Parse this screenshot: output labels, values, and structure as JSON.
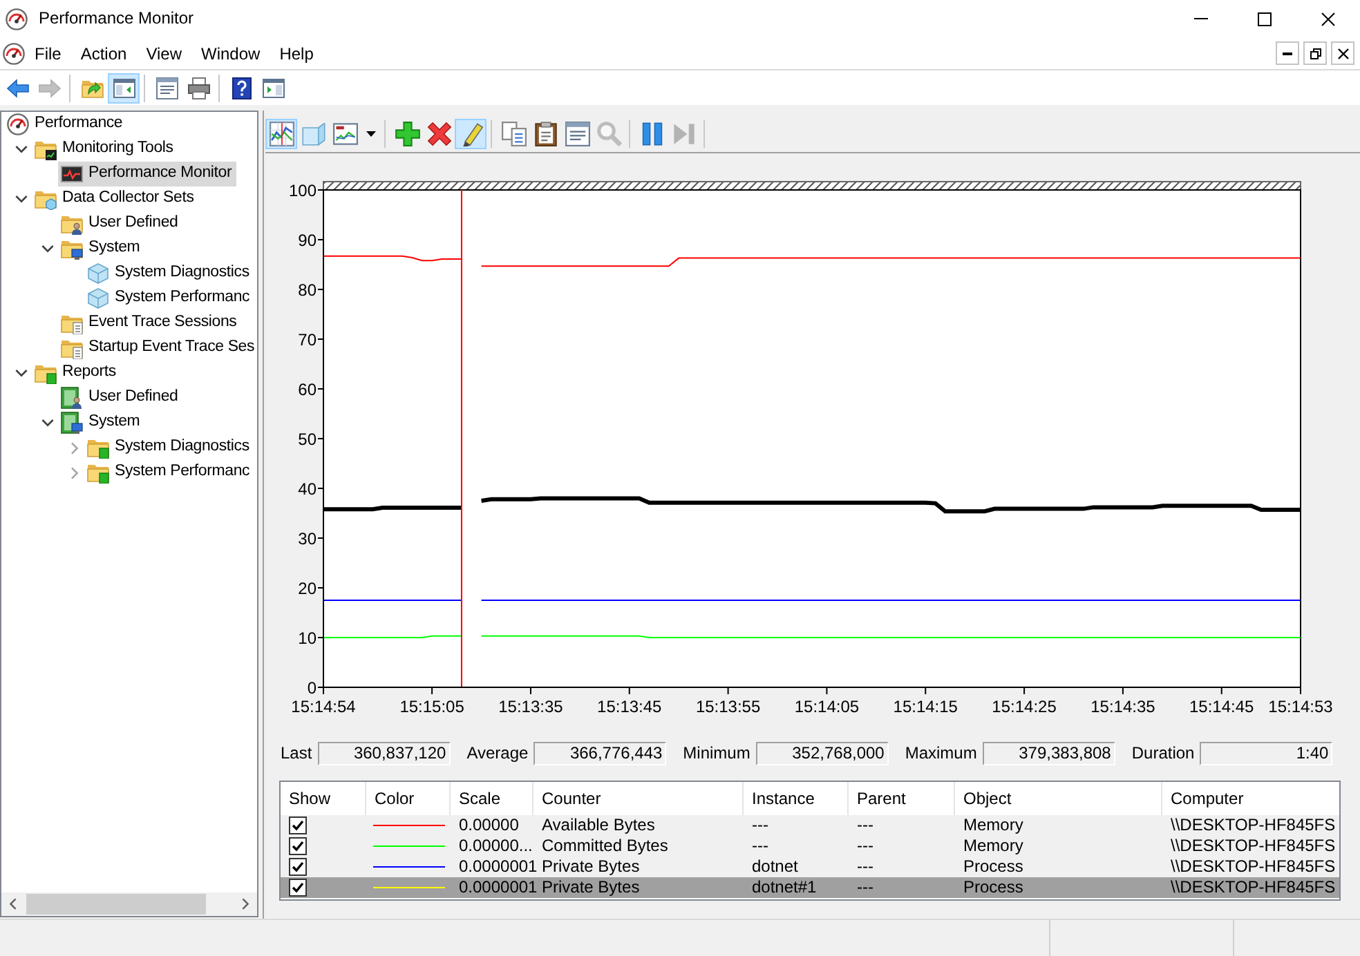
{
  "window": {
    "title": "Performance Monitor"
  },
  "menu": [
    "File",
    "Action",
    "View",
    "Window",
    "Help"
  ],
  "toolbar": [
    {
      "kind": "back",
      "pressed": false,
      "disabled": false
    },
    {
      "kind": "forward",
      "pressed": false,
      "disabled": true
    },
    {
      "kind": "separator"
    },
    {
      "kind": "up",
      "pressed": false,
      "disabled": false
    },
    {
      "kind": "consoletree",
      "pressed": true,
      "disabled": false
    },
    {
      "kind": "separator"
    },
    {
      "kind": "properties",
      "pressed": false,
      "disabled": false
    },
    {
      "kind": "print",
      "pressed": false,
      "disabled": false
    },
    {
      "kind": "separator"
    },
    {
      "kind": "help",
      "pressed": false,
      "disabled": false
    },
    {
      "kind": "actionpane",
      "pressed": false,
      "disabled": false
    }
  ],
  "tree": [
    {
      "label": "Performance",
      "kind": "root",
      "selected": false,
      "children": [
        {
          "label": "Monitoring Tools",
          "kind": "tools",
          "expanded": true,
          "selected": false,
          "children": [
            {
              "label": "Performance Monitor",
              "kind": "monitor",
              "selected": true
            }
          ]
        },
        {
          "label": "Data Collector Sets",
          "kind": "collector",
          "expanded": true,
          "selected": false,
          "children": [
            {
              "label": "User Defined",
              "kind": "userset",
              "selected": false
            },
            {
              "label": "System",
              "kind": "systemset",
              "expanded": true,
              "selected": false,
              "children": [
                {
                  "label": "System Diagnostics",
                  "kind": "dataset",
                  "selected": false
                },
                {
                  "label": "System Performanc",
                  "kind": "dataset",
                  "selected": false
                }
              ]
            },
            {
              "label": "Event Trace Sessions",
              "kind": "trace",
              "selected": false
            },
            {
              "label": "Startup Event Trace Ses",
              "kind": "trace",
              "selected": false
            }
          ]
        },
        {
          "label": "Reports",
          "kind": "reports",
          "expanded": true,
          "selected": false,
          "children": [
            {
              "label": "User Defined",
              "kind": "userreport",
              "selected": false
            },
            {
              "label": "System",
              "kind": "systemreport",
              "expanded": true,
              "selected": false,
              "children": [
                {
                  "label": "System Diagnostics",
                  "kind": "reportfolder",
                  "expanded": false,
                  "selected": false
                },
                {
                  "label": "System Performanc",
                  "kind": "reportfolder",
                  "expanded": false,
                  "selected": false
                }
              ]
            }
          ]
        }
      ]
    }
  ],
  "graph_toolbar": [
    {
      "kind": "graph",
      "pressed": true,
      "disabled": false
    },
    {
      "kind": "histogram",
      "pressed": false,
      "disabled": false
    },
    {
      "kind": "report",
      "pressed": false,
      "disabled": false
    },
    {
      "kind": "dropdown",
      "pressed": false,
      "disabled": false
    },
    {
      "kind": "separator"
    },
    {
      "kind": "add",
      "pressed": false,
      "disabled": false
    },
    {
      "kind": "delete",
      "pressed": false,
      "disabled": false
    },
    {
      "kind": "highlight",
      "pressed": true,
      "disabled": false
    },
    {
      "kind": "separator"
    },
    {
      "kind": "copy",
      "pressed": false,
      "disabled": false
    },
    {
      "kind": "paste",
      "pressed": false,
      "disabled": false
    },
    {
      "kind": "properties",
      "pressed": false,
      "disabled": false
    },
    {
      "kind": "zoom",
      "pressed": false,
      "disabled": true
    },
    {
      "kind": "separator"
    },
    {
      "kind": "freeze",
      "pressed": false,
      "disabled": false
    },
    {
      "kind": "update",
      "pressed": false,
      "disabled": true
    },
    {
      "kind": "separator"
    }
  ],
  "graph": {
    "chart_data": {
      "type": "line",
      "categories": [
        "15:14:54",
        null,
        null,
        null,
        null,
        null,
        null,
        null,
        null,
        null,
        null,
        "15:15:05",
        null,
        null,
        null,
        null,
        null,
        null,
        null,
        null,
        null,
        "15:13:35",
        null,
        null,
        null,
        null,
        null,
        null,
        null,
        null,
        null,
        "15:13:45",
        null,
        null,
        null,
        null,
        null,
        null,
        null,
        null,
        null,
        "15:13:55",
        null,
        null,
        null,
        null,
        null,
        null,
        null,
        null,
        null,
        "15:14:05",
        null,
        null,
        null,
        null,
        null,
        null,
        null,
        null,
        null,
        "15:14:15",
        null,
        null,
        null,
        null,
        null,
        null,
        null,
        null,
        null,
        "15:14:25",
        null,
        null,
        null,
        null,
        null,
        null,
        null,
        null,
        null,
        "15:14:35",
        null,
        null,
        null,
        null,
        null,
        null,
        null,
        null,
        null,
        "15:14:45",
        null,
        null,
        null,
        null,
        null,
        null,
        null,
        "15:14:53"
      ],
      "series": [
        {
          "color": "#ff0000",
          "values": [
            86.7,
            86.7,
            86.7,
            86.7,
            86.7,
            86.7,
            86.7,
            86.7,
            86.7,
            86.4,
            85.8,
            85.8,
            86.1,
            86.1,
            86.1,
            null,
            84.7,
            84.7,
            84.7,
            84.7,
            84.7,
            84.7,
            84.7,
            84.7,
            84.7,
            84.7,
            84.7,
            84.7,
            84.7,
            84.7,
            84.7,
            84.7,
            84.7,
            84.7,
            84.7,
            84.7,
            86.3,
            86.3,
            86.3,
            86.3,
            86.3,
            86.3,
            86.3,
            86.3,
            86.3,
            86.3,
            86.3,
            86.3,
            86.3,
            86.3,
            86.3,
            86.3,
            86.3,
            86.3,
            86.3,
            86.3,
            86.3,
            86.3,
            86.3,
            86.3,
            86.3,
            86.3,
            86.3,
            86.3,
            86.3,
            86.3,
            86.3,
            86.3,
            86.3,
            86.3,
            86.3,
            86.3,
            86.3,
            86.3,
            86.3,
            86.3,
            86.3,
            86.3,
            86.3,
            86.3,
            86.3,
            86.3,
            86.3,
            86.3,
            86.3,
            86.3,
            86.3,
            86.3,
            86.3,
            86.3,
            86.3,
            86.3,
            86.3,
            86.3,
            86.3,
            86.3,
            86.3,
            86.3,
            86.3,
            86.3
          ]
        },
        {
          "color": "#00ff00",
          "values": [
            10,
            10,
            10,
            10,
            10,
            10,
            10,
            10,
            10,
            10,
            10,
            10.3,
            10.3,
            10.3,
            10.3,
            null,
            10.3,
            10.3,
            10.3,
            10.3,
            10.3,
            10.3,
            10.3,
            10.3,
            10.3,
            10.3,
            10.3,
            10.3,
            10.3,
            10.3,
            10.3,
            10.3,
            10.3,
            10,
            10,
            10,
            10,
            10,
            10,
            10,
            10,
            10,
            10,
            10,
            10,
            10,
            10,
            10,
            10,
            10,
            10,
            10,
            10,
            10,
            10,
            10,
            10,
            10,
            10,
            10,
            10,
            10,
            10,
            10,
            10,
            10,
            10,
            10,
            10,
            10,
            10,
            10,
            10,
            10,
            10,
            10,
            10,
            10,
            10,
            10,
            10,
            10,
            10,
            10,
            10,
            10,
            10,
            10,
            10,
            10,
            10,
            10,
            10,
            10,
            10,
            10,
            10,
            10,
            10,
            10
          ]
        },
        {
          "color": "#0000ff",
          "values": [
            17.5,
            17.5,
            17.5,
            17.5,
            17.5,
            17.5,
            17.5,
            17.5,
            17.5,
            17.5,
            17.5,
            17.5,
            17.5,
            17.5,
            17.5,
            null,
            17.5,
            17.5,
            17.5,
            17.5,
            17.5,
            17.5,
            17.5,
            17.5,
            17.5,
            17.5,
            17.5,
            17.5,
            17.5,
            17.5,
            17.5,
            17.5,
            17.5,
            17.5,
            17.5,
            17.5,
            17.5,
            17.5,
            17.5,
            17.5,
            17.5,
            17.5,
            17.5,
            17.5,
            17.5,
            17.5,
            17.5,
            17.5,
            17.5,
            17.5,
            17.5,
            17.5,
            17.5,
            17.5,
            17.5,
            17.5,
            17.5,
            17.5,
            17.5,
            17.5,
            17.5,
            17.5,
            17.5,
            17.5,
            17.5,
            17.5,
            17.5,
            17.5,
            17.5,
            17.5,
            17.5,
            17.5,
            17.5,
            17.5,
            17.5,
            17.5,
            17.5,
            17.5,
            17.5,
            17.5,
            17.5,
            17.5,
            17.5,
            17.5,
            17.5,
            17.5,
            17.5,
            17.5,
            17.5,
            17.5,
            17.5,
            17.5,
            17.5,
            17.5,
            17.5,
            17.5,
            17.5,
            17.5,
            17.5,
            17.5
          ]
        },
        {
          "color": "#000000",
          "values": [
            35.8,
            35.8,
            35.8,
            35.8,
            35.8,
            35.8,
            36.1,
            36.1,
            36.1,
            36.1,
            36.1,
            36.1,
            36.1,
            36.1,
            36.1,
            null,
            37.5,
            37.8,
            37.8,
            37.8,
            37.8,
            37.8,
            38,
            38,
            38,
            38,
            38,
            38,
            38,
            38,
            38,
            38,
            38,
            37.1,
            37.1,
            37.1,
            37.1,
            37.1,
            37.1,
            37.1,
            37.1,
            37.1,
            37.1,
            37.1,
            37.1,
            37.1,
            37.1,
            37.1,
            37.1,
            37.1,
            37.1,
            37.1,
            37.1,
            37.1,
            37.1,
            37.1,
            37.1,
            37.1,
            37.1,
            37.1,
            37.1,
            37.1,
            37,
            35.4,
            35.4,
            35.4,
            35.4,
            35.4,
            35.9,
            35.9,
            35.9,
            35.9,
            35.9,
            35.9,
            35.9,
            35.9,
            35.9,
            35.9,
            36.2,
            36.2,
            36.2,
            36.2,
            36.2,
            36.2,
            36.2,
            36.5,
            36.5,
            36.5,
            36.5,
            36.5,
            36.5,
            36.5,
            36.5,
            36.5,
            36.5,
            35.7,
            35.7,
            35.7,
            35.7,
            35.7
          ]
        }
      ],
      "ylim": [
        0,
        100
      ],
      "yticks": [
        0,
        10,
        20,
        30,
        40,
        50,
        60,
        70,
        80,
        90,
        100
      ]
    }
  },
  "stats": [
    {
      "label": "Last",
      "value": "360,837,120"
    },
    {
      "label": "Average",
      "value": "366,776,443"
    },
    {
      "label": "Minimum",
      "value": "352,768,000"
    },
    {
      "label": "Maximum",
      "value": "379,383,808"
    },
    {
      "label": "Duration",
      "value": "1:40"
    }
  ],
  "legend": {
    "columns": [
      "Show",
      "Color",
      "Scale",
      "Counter",
      "Instance",
      "Parent",
      "Object",
      "Computer"
    ],
    "rows": [
      {
        "checked": true,
        "color": "#ff0000",
        "scale": "0.00000",
        "counter": "Available Bytes",
        "instance": "---",
        "parent": "---",
        "object": "Memory",
        "computer": "\\\\DESKTOP-HF845FS",
        "selected": false
      },
      {
        "checked": true,
        "color": "#00ff00",
        "scale": "0.00000...",
        "counter": "Committed Bytes",
        "instance": "---",
        "parent": "---",
        "object": "Memory",
        "computer": "\\\\DESKTOP-HF845FS",
        "selected": false
      },
      {
        "checked": true,
        "color": "#0000ff",
        "scale": "0.0000001",
        "counter": "Private Bytes",
        "instance": "dotnet",
        "parent": "---",
        "object": "Process",
        "computer": "\\\\DESKTOP-HF845FS",
        "selected": false
      },
      {
        "checked": true,
        "color": "#ffff00",
        "scale": "0.0000001",
        "counter": "Private Bytes",
        "instance": "dotnet#1",
        "parent": "---",
        "object": "Process",
        "computer": "\\\\DESKTOP-HF845FS",
        "selected": true
      }
    ]
  }
}
